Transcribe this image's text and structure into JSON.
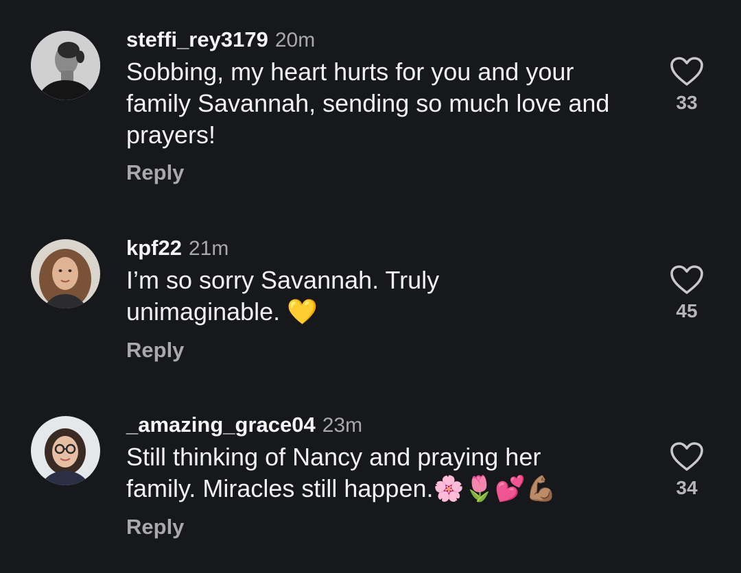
{
  "colors": {
    "background": "#17181c",
    "text_primary": "#f2f2f2",
    "text_secondary": "#a8a8ad"
  },
  "comments": [
    {
      "username": "steffi_rey3179",
      "time": "20m",
      "text": "Sobbing, my heart hurts for you and your family Savannah, sending so much love and prayers!",
      "emoji": "",
      "reply_label": "Reply",
      "like_icon": "heart-outline-icon",
      "likes": "33"
    },
    {
      "username": "kpf22",
      "time": "21m",
      "text": "I’m so sorry Savannah. Truly unimaginable.",
      "emoji": "💛",
      "reply_label": "Reply",
      "like_icon": "heart-outline-icon",
      "likes": "45"
    },
    {
      "username": "_amazing_grace04",
      "time": "23m",
      "text": "Still thinking of Nancy and praying her family. Miracles still happen.",
      "emoji": "🌸🌷💕💪🏽",
      "reply_label": "Reply",
      "like_icon": "heart-outline-icon",
      "likes": "34"
    }
  ]
}
